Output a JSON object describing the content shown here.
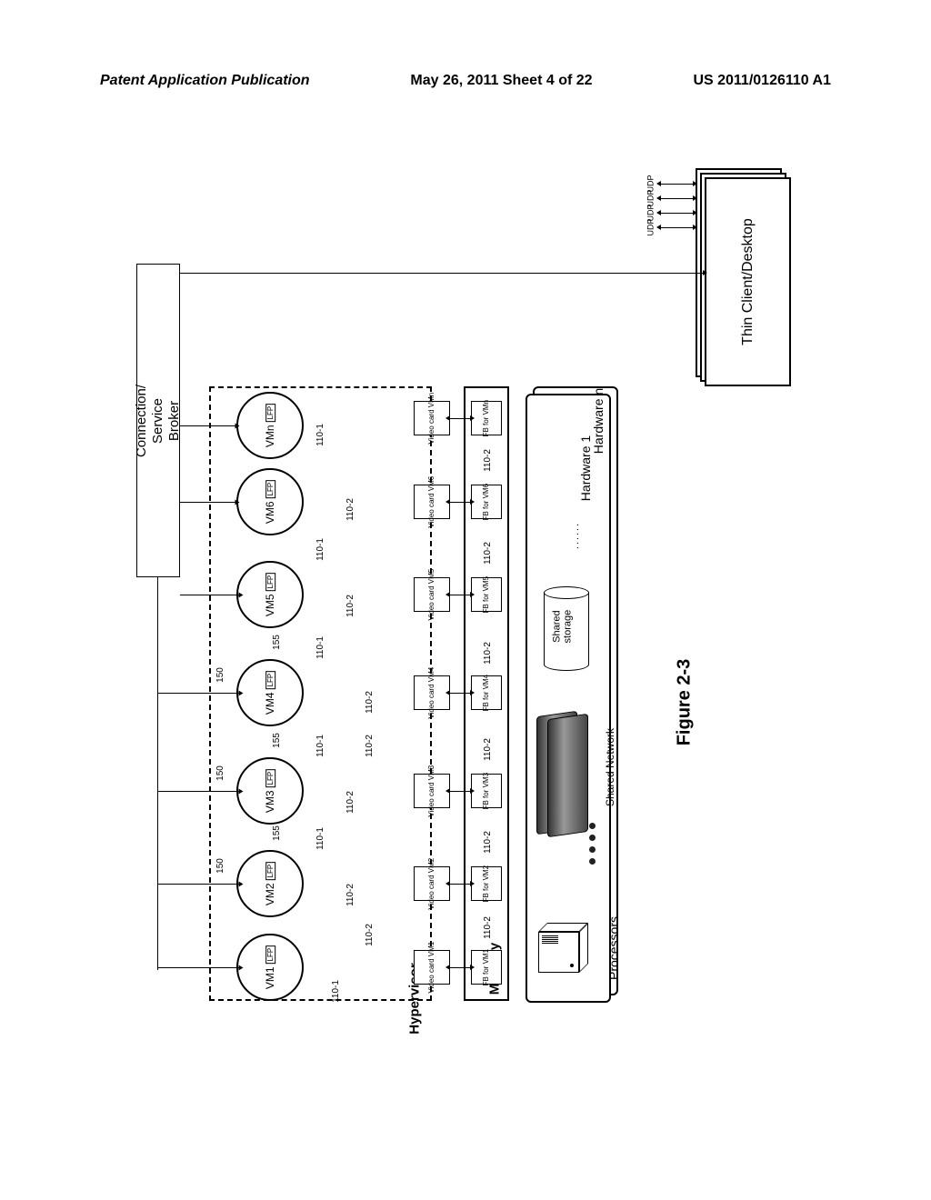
{
  "header": {
    "left": "Patent Application Publication",
    "center": "May 26, 2011  Sheet 4 of 22",
    "right": "US 2011/0126110 A1"
  },
  "figure_label": "Figure 2-3",
  "client_stack_label": "Thin Client/Desktop",
  "udp_label": "UDP",
  "service_broker_label_line1": "Connection/",
  "service_broker_label_line2": "Service Broker",
  "hypervisor_label": "Hypervisor",
  "memory_label": "Memory",
  "hardware_labels": {
    "hw1": "Hardware 1",
    "hwn": "Hardware n"
  },
  "processors_label": "Processors",
  "shared_network_label": "Shared Network",
  "shared_storage_label_line1": "Shared",
  "shared_storage_label_line2": "storage",
  "lfp": "LFP",
  "ref_150": "150",
  "ref_155": "155",
  "ref_110_1": "110-1",
  "ref_110_2": "110-2",
  "vms": [
    {
      "name": "VM1",
      "vcard": "Video\ncard\nVM1",
      "fb": "FB for\nVM1"
    },
    {
      "name": "VM2",
      "vcard": "Video\ncard\nVM2",
      "fb": "FB for\nVM2"
    },
    {
      "name": "VM3",
      "vcard": "Video\ncard\nVM3",
      "fb": "FB for\nVM3"
    },
    {
      "name": "VM4",
      "vcard": "Video\ncard\nVM4",
      "fb": "FB for\nVM4"
    },
    {
      "name": "VM5",
      "vcard": "Video\ncard\nVM5",
      "fb": "FB for\nVM5"
    },
    {
      "name": "VM6",
      "vcard": "Video\ncard\nVM6",
      "fb": "FB for\nVM6"
    },
    {
      "name": "VMn",
      "vcard": "Video\ncard\nVMn",
      "fb": "FB for\nVMn"
    }
  ],
  "ellipsis": "......"
}
